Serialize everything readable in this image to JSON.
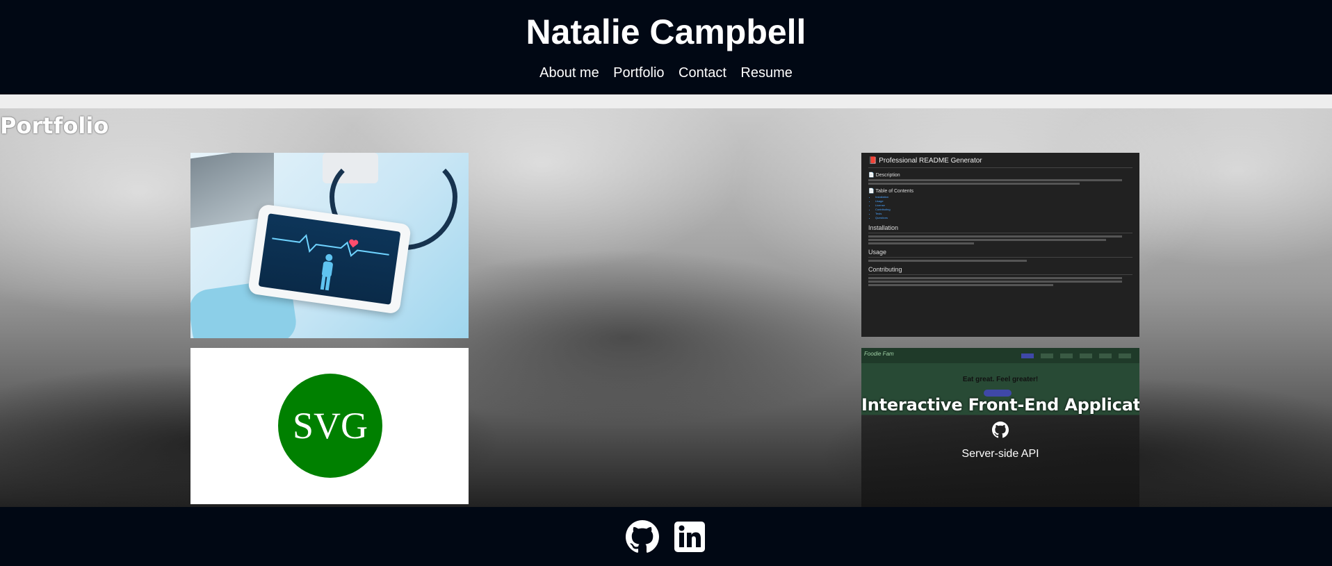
{
  "header": {
    "title": "Natalie Campbell",
    "nav": [
      "About me",
      "Portfolio",
      "Contact",
      "Resume"
    ]
  },
  "portfolio": {
    "title": "Portfolio",
    "cards": [
      {
        "image": "health-tech-photo"
      },
      {
        "image": "svg-logo",
        "logo_text": "SVG"
      },
      {
        "image": "readme-screenshot",
        "readme": {
          "title": "📕 Professional README Generator",
          "description_heading": "📄 Description",
          "toc_heading": "📄 Table of Contents",
          "toc_items": [
            "Installation",
            "Usage",
            "License",
            "Contributing",
            "Tests",
            "Questions"
          ],
          "installation_heading": "Installation",
          "usage_heading": "Usage",
          "contributing_heading": "Contributing"
        }
      },
      {
        "image": "eat-great-screenshot",
        "screenshot": {
          "brand": "Foodie Fam",
          "tagline": "Eat great. Feel greater!"
        },
        "title": "Interactive Front-End Application",
        "subtitle": "Server-side API"
      }
    ]
  },
  "footer": {
    "icons": [
      "github-icon",
      "linkedin-icon"
    ]
  },
  "colors": {
    "header_bg": "#010814",
    "svg_green": "#008000",
    "readme_bg": "#212121"
  }
}
